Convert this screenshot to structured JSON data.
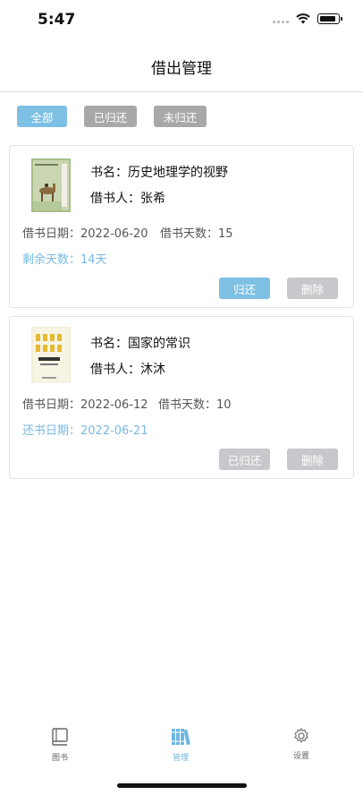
{
  "status": {
    "time": "5:47"
  },
  "nav": {
    "title": "借出管理"
  },
  "filters": [
    {
      "label": "全部",
      "active": true
    },
    {
      "label": "已归还",
      "active": false
    },
    {
      "label": "未归还",
      "active": false
    }
  ],
  "cards": [
    {
      "title_line": "书名：历史地理学的视野",
      "borrower_line": "借书人：张希",
      "date_line": "借书日期：2022-06-20",
      "days_line": "借书天数：15",
      "status_line": "剩余天数：14天",
      "primary_button": "归还",
      "delete_button": "删除"
    },
    {
      "title_line": "书名：国家的常识",
      "borrower_line": "借书人：沐沐",
      "date_line": "借书日期：2022-06-12",
      "days_line": "借书天数：10",
      "status_line": "还书日期：2022-06-21",
      "primary_button": "已归还",
      "delete_button": "删除"
    }
  ],
  "tabs": [
    {
      "label": "图书",
      "icon": "book-icon"
    },
    {
      "label": "管理",
      "icon": "bookshelf-icon",
      "active": true
    },
    {
      "label": "设置",
      "icon": "gear-icon"
    }
  ],
  "colors": {
    "accent": "#7ec0e4",
    "inactive_button": "#c7c7cc",
    "filter_grey": "#a8a8a8"
  }
}
